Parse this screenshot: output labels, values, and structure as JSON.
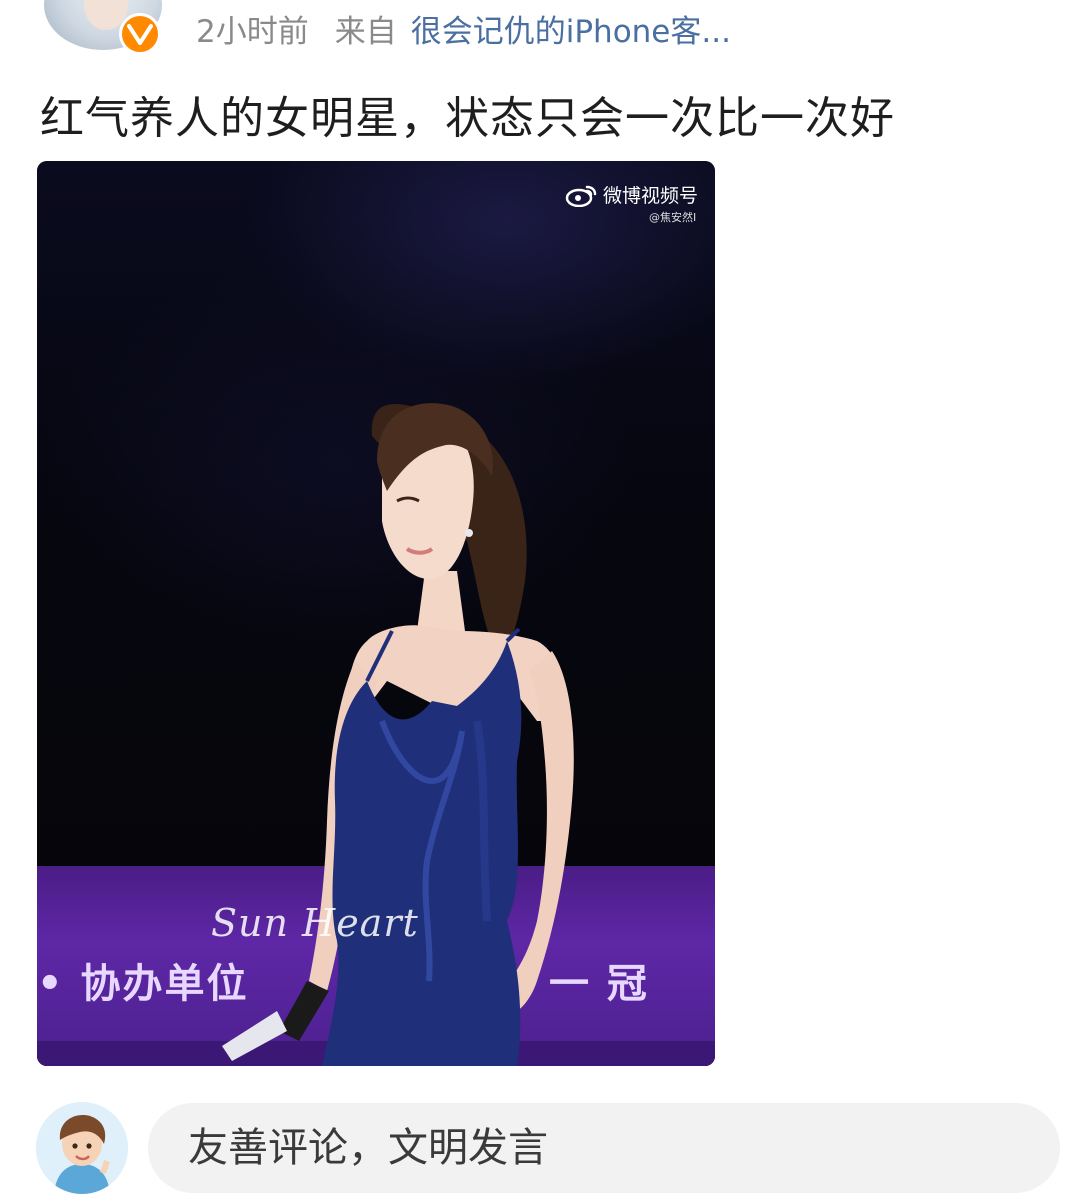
{
  "post": {
    "time": "2小时前",
    "from_label": "来自",
    "source": "很会记仇的iPhone客...",
    "text": "红气养人的女明星，状态只会一次比一次好"
  },
  "media": {
    "watermark": "微博视频号",
    "watermark_user": "@焦安然I",
    "signature": "Sun Heart",
    "banner_left": "• 协办单位",
    "banner_right": "一 冠"
  },
  "comment": {
    "placeholder": "友善评论，文明发言"
  },
  "colors": {
    "verified_badge": "#ff8a00",
    "source_link": "#4a6fa0",
    "meta_gray": "#8a8a8a",
    "stage_purple": "#5e27a6",
    "dress_blue": "#1f2f7a"
  },
  "icons": {
    "verified": "verified-v-icon",
    "weibo": "weibo-logo-icon"
  }
}
